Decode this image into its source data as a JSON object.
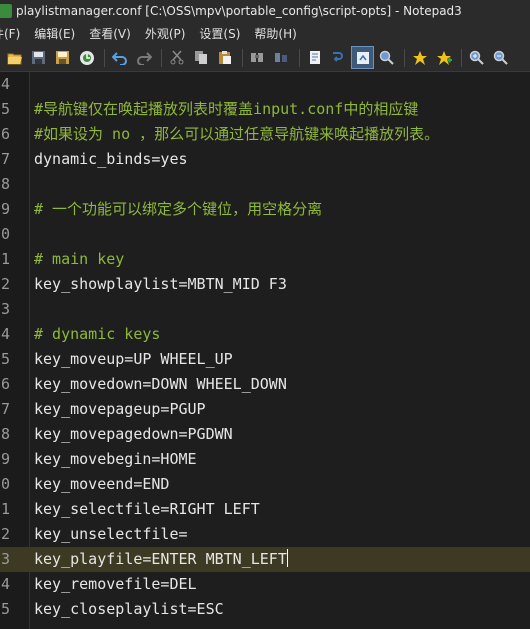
{
  "window": {
    "title": "playlistmanager.conf [C:\\OSS\\mpv\\portable_config\\script-opts] - Notepad3"
  },
  "menu": [
    "件(F)",
    "编辑(E)",
    "查看(V)",
    "外观(P)",
    "设置(S)",
    "帮助(H)"
  ],
  "toolbar": {
    "icons": [
      "open-folder-icon",
      "save-icon",
      "save-as-icon",
      "browse-icon",
      "undo-icon",
      "redo-icon",
      "cut-icon",
      "copy-icon",
      "paste-icon",
      "find-icon",
      "replace-icon",
      "word-wrap-icon",
      "view-whitespace-icon",
      "zoom-page-icon",
      "add-favorite-icon",
      "favorites-icon",
      "zoom-in-icon",
      "zoom-out-icon"
    ],
    "active_index": 12
  },
  "editor": {
    "current_line_index": 19,
    "lines": [
      {
        "no": "4",
        "text": "",
        "type": "code"
      },
      {
        "no": "5",
        "text": "#导航键仅在唤起播放列表时覆盖input.conf中的相应键",
        "type": "comment"
      },
      {
        "no": "6",
        "text": "#如果设为 no ，那么可以通过任意导航键来唤起播放列表。",
        "type": "comment"
      },
      {
        "no": "7",
        "text": "dynamic_binds=yes",
        "type": "code"
      },
      {
        "no": "8",
        "text": "",
        "type": "code"
      },
      {
        "no": "9",
        "text": "# 一个功能可以绑定多个键位，用空格分离",
        "type": "comment"
      },
      {
        "no": "0",
        "text": "",
        "type": "code"
      },
      {
        "no": "1",
        "text": "# main key",
        "type": "comment"
      },
      {
        "no": "2",
        "text": "key_showplaylist=MBTN_MID F3",
        "type": "code"
      },
      {
        "no": "3",
        "text": "",
        "type": "code"
      },
      {
        "no": "4",
        "text": "# dynamic keys",
        "type": "comment"
      },
      {
        "no": "5",
        "text": "key_moveup=UP WHEEL_UP",
        "type": "code"
      },
      {
        "no": "6",
        "text": "key_movedown=DOWN WHEEL_DOWN",
        "type": "code"
      },
      {
        "no": "7",
        "text": "key_movepageup=PGUP",
        "type": "code"
      },
      {
        "no": "8",
        "text": "key_movepagedown=PGDWN",
        "type": "code"
      },
      {
        "no": "9",
        "text": "key_movebegin=HOME",
        "type": "code"
      },
      {
        "no": "0",
        "text": "key_moveend=END",
        "type": "code"
      },
      {
        "no": "1",
        "text": "key_selectfile=RIGHT LEFT",
        "type": "code"
      },
      {
        "no": "2",
        "text": "key_unselectfile=",
        "type": "code"
      },
      {
        "no": "3",
        "text": "key_playfile=ENTER MBTN_LEFT",
        "type": "code"
      },
      {
        "no": "4",
        "text": "key_removefile=DEL",
        "type": "code"
      },
      {
        "no": "5",
        "text": "key_closeplaylist=ESC",
        "type": "code"
      }
    ]
  }
}
